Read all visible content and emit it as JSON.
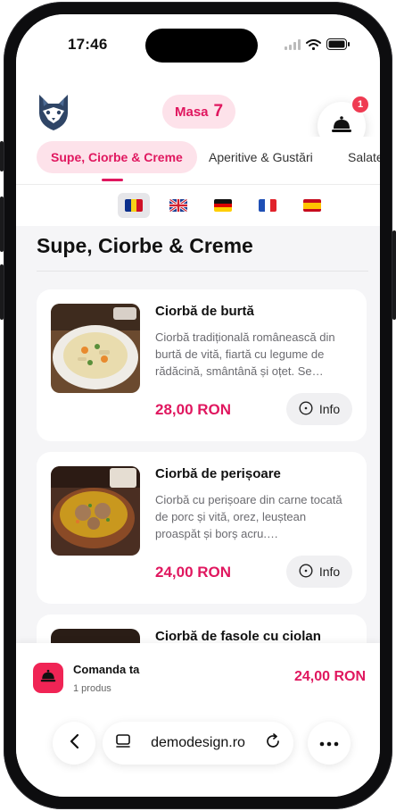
{
  "status_bar": {
    "time": "17:46"
  },
  "header": {
    "table_label": "Masa",
    "table_number": "7",
    "cart_badge": "1"
  },
  "categories": [
    {
      "label": "Supe, Ciorbe & Creme",
      "active": true
    },
    {
      "label": "Aperitive & Gustări",
      "active": false
    },
    {
      "label": "Salate",
      "active": false
    }
  ],
  "languages": [
    {
      "code": "ro",
      "icon": "flag-ro-icon",
      "active": true
    },
    {
      "code": "en",
      "icon": "flag-gb-icon",
      "active": false
    },
    {
      "code": "de",
      "icon": "flag-de-icon",
      "active": false
    },
    {
      "code": "fr",
      "icon": "flag-fr-icon",
      "active": false
    },
    {
      "code": "es",
      "icon": "flag-es-icon",
      "active": false
    }
  ],
  "section": {
    "title": "Supe, Ciorbe & Creme"
  },
  "products": [
    {
      "name": "Ciorbă de burtă",
      "description": "Ciorbă tradițională românească din burtă de vită, fiartă cu legume de rădăcină, smântână și oțet. Se…",
      "price": "28,00 RON",
      "info_label": "Info"
    },
    {
      "name": "Ciorbă de perișoare",
      "description": "Ciorbă cu perișoare din carne tocată de porc și vită, orez, leuștean proaspăt și borș acru.…",
      "price": "24,00 RON",
      "info_label": "Info"
    },
    {
      "name": "Ciorbă de fasole cu ciolan",
      "description": "",
      "price": "",
      "info_label": ""
    }
  ],
  "order": {
    "title": "Comanda ta",
    "count": "1 produs",
    "total": "24,00 RON"
  },
  "browser": {
    "url": "demodesign.ro"
  },
  "colors": {
    "accent": "#e0175f",
    "accent_soft": "#fde2ea",
    "badge": "#ef3b52"
  }
}
